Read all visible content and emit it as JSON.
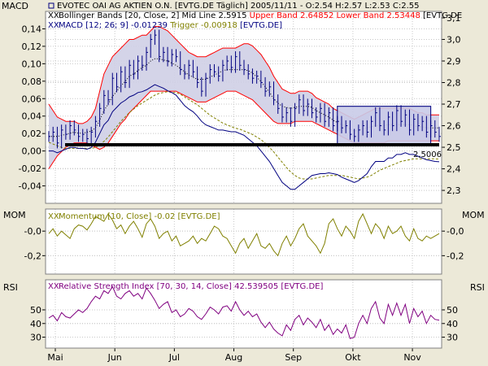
{
  "colors": {
    "background": "#ece9d8",
    "plot_bg": "#ffffff",
    "grid": "#c8c8c8",
    "price": "#000080",
    "band": "#ff0000",
    "band_fill": "#cfcfe6",
    "mid": "#000000",
    "macd": "#000080",
    "trigger": "#808000",
    "momentum": "#808000",
    "rsi": "#800080",
    "support": "#000000",
    "rect": "#000080",
    "rect_fill": "#c9cbe8"
  },
  "panels": {
    "macd_label_left": "MACD",
    "mom_label_left": "MOM",
    "mom_label_right": "MOM",
    "rsi_label_left": "RSI",
    "rsi_label_right": "RSI"
  },
  "legend": {
    "line1": "EVOTEC OAI AG AKTIEN O.N. [EVTG.DE  Täglich] 2005/11/11 - O:2.54 H:2.57 L:2.53 C:2.55",
    "line2_a": "Bollinger Bands [20, Close, 2] Mid Line 2.5915 ",
    "line2_b": "Upper Band 2.64852 Lower Band 2.53448",
    "line2_c": " [EVTG.DE",
    "line3_a": "MACD [12; 26; 9] -0.01239 ",
    "line3_b": "Trigger -0.00918",
    "line3_c": " [EVTG.DE]",
    "mom": "Momentum [10, Close] -0.02 [EVTG.DE]",
    "rsi": "Relative Strength Index [70, 30, 14, Close] 42.539505 [EVTG.DE]",
    "support_value": "2,5006"
  },
  "chart_data": {
    "type": "line",
    "x_months": [
      "Mai",
      "Jun",
      "Jul",
      "Aug",
      "Sep",
      "Okt",
      "Nov"
    ],
    "main": {
      "y_left_ticks": [
        "0,14",
        "0,12",
        "0,10",
        "0,08",
        "0,06",
        "0,04",
        "0,02",
        "0,00",
        "-0,02",
        "-0,04"
      ],
      "y_left_range": [
        -0.06,
        0.16
      ],
      "y_right_ticks": [
        "3,1",
        "3,0",
        "2,9",
        "2,8",
        "2,7",
        "2,6",
        "2,5",
        "2,4",
        "2,3"
      ],
      "y_right_range": [
        2.24,
        3.13
      ],
      "price": [
        2.55,
        2.57,
        2.52,
        2.58,
        2.56,
        2.6,
        2.58,
        2.55,
        2.56,
        2.54,
        2.57,
        2.62,
        2.68,
        2.74,
        2.72,
        2.82,
        2.78,
        2.85,
        2.8,
        2.88,
        2.84,
        2.9,
        2.88,
        2.94,
        3.0,
        3.02,
        2.92,
        2.94,
        2.9,
        2.93,
        2.92,
        2.86,
        2.84,
        2.88,
        2.85,
        2.8,
        2.76,
        2.82,
        2.86,
        2.85,
        2.83,
        2.88,
        2.9,
        2.87,
        2.92,
        2.88,
        2.86,
        2.84,
        2.82,
        2.83,
        2.8,
        2.76,
        2.78,
        2.72,
        2.68,
        2.64,
        2.66,
        2.62,
        2.68,
        2.72,
        2.67,
        2.7,
        2.66,
        2.64,
        2.68,
        2.62,
        2.66,
        2.6,
        2.62,
        2.59,
        2.6,
        2.56,
        2.55,
        2.58,
        2.6,
        2.57,
        2.62,
        2.66,
        2.6,
        2.58,
        2.64,
        2.6,
        2.67,
        2.62,
        2.65,
        2.58,
        2.63,
        2.6,
        2.62,
        2.57,
        2.6,
        2.57,
        2.55
      ],
      "upper_band": [
        2.7,
        2.67,
        2.64,
        2.63,
        2.62,
        2.62,
        2.62,
        2.61,
        2.61,
        2.62,
        2.64,
        2.68,
        2.76,
        2.84,
        2.88,
        2.92,
        2.94,
        2.96,
        2.98,
        3.0,
        3.0,
        3.01,
        3.02,
        3.02,
        3.04,
        3.06,
        3.06,
        3.05,
        3.04,
        3.02,
        3.0,
        2.98,
        2.96,
        2.94,
        2.93,
        2.92,
        2.92,
        2.92,
        2.93,
        2.94,
        2.95,
        2.96,
        2.96,
        2.96,
        2.96,
        2.97,
        2.98,
        2.98,
        2.97,
        2.95,
        2.93,
        2.9,
        2.87,
        2.83,
        2.8,
        2.77,
        2.76,
        2.75,
        2.75,
        2.76,
        2.76,
        2.76,
        2.75,
        2.73,
        2.72,
        2.71,
        2.7,
        2.68,
        2.67,
        2.66,
        2.65,
        2.64,
        2.63,
        2.64,
        2.65,
        2.66,
        2.67,
        2.68,
        2.68,
        2.68,
        2.68,
        2.68,
        2.68,
        2.68,
        2.68,
        2.68,
        2.67,
        2.66,
        2.66,
        2.65,
        2.65,
        2.65,
        2.65
      ],
      "lower_band": [
        2.4,
        2.43,
        2.46,
        2.48,
        2.5,
        2.51,
        2.52,
        2.52,
        2.52,
        2.52,
        2.51,
        2.5,
        2.49,
        2.5,
        2.52,
        2.55,
        2.58,
        2.61,
        2.63,
        2.66,
        2.68,
        2.7,
        2.72,
        2.74,
        2.76,
        2.76,
        2.76,
        2.76,
        2.76,
        2.76,
        2.76,
        2.75,
        2.74,
        2.73,
        2.72,
        2.71,
        2.71,
        2.71,
        2.72,
        2.73,
        2.74,
        2.75,
        2.76,
        2.76,
        2.76,
        2.75,
        2.74,
        2.73,
        2.72,
        2.7,
        2.68,
        2.66,
        2.64,
        2.62,
        2.61,
        2.61,
        2.61,
        2.61,
        2.62,
        2.62,
        2.62,
        2.62,
        2.62,
        2.61,
        2.6,
        2.59,
        2.58,
        2.57,
        2.56,
        2.55,
        2.54,
        2.53,
        2.52,
        2.52,
        2.52,
        2.52,
        2.52,
        2.52,
        2.52,
        2.52,
        2.53,
        2.53,
        2.53,
        2.53,
        2.53,
        2.53,
        2.53,
        2.53,
        2.53,
        2.53,
        2.53,
        2.53,
        2.53
      ],
      "macd": [
        0.0,
        0.0,
        -0.002,
        0.0,
        0.002,
        0.004,
        0.004,
        0.003,
        0.003,
        0.002,
        0.004,
        0.01,
        0.02,
        0.03,
        0.035,
        0.045,
        0.05,
        0.055,
        0.058,
        0.062,
        0.064,
        0.067,
        0.068,
        0.07,
        0.073,
        0.076,
        0.074,
        0.072,
        0.069,
        0.067,
        0.064,
        0.058,
        0.052,
        0.048,
        0.045,
        0.04,
        0.034,
        0.03,
        0.028,
        0.026,
        0.024,
        0.024,
        0.023,
        0.022,
        0.022,
        0.02,
        0.018,
        0.014,
        0.01,
        0.006,
        0.0,
        -0.006,
        -0.012,
        -0.02,
        -0.028,
        -0.036,
        -0.04,
        -0.044,
        -0.044,
        -0.04,
        -0.036,
        -0.032,
        -0.028,
        -0.027,
        -0.026,
        -0.026,
        -0.025,
        -0.026,
        -0.027,
        -0.03,
        -0.032,
        -0.034,
        -0.036,
        -0.034,
        -0.03,
        -0.026,
        -0.018,
        -0.012,
        -0.012,
        -0.012,
        -0.008,
        -0.008,
        -0.004,
        -0.004,
        -0.002,
        -0.004,
        -0.004,
        -0.006,
        -0.008,
        -0.01,
        -0.011,
        -0.012,
        -0.0124
      ],
      "trigger": [
        0.01,
        0.008,
        0.006,
        0.004,
        0.003,
        0.003,
        0.003,
        0.003,
        0.003,
        0.003,
        0.003,
        0.004,
        0.007,
        0.011,
        0.016,
        0.022,
        0.028,
        0.034,
        0.039,
        0.044,
        0.048,
        0.052,
        0.055,
        0.058,
        0.061,
        0.064,
        0.066,
        0.067,
        0.068,
        0.067,
        0.067,
        0.065,
        0.062,
        0.059,
        0.056,
        0.053,
        0.049,
        0.045,
        0.041,
        0.038,
        0.035,
        0.032,
        0.03,
        0.028,
        0.026,
        0.025,
        0.023,
        0.021,
        0.019,
        0.016,
        0.013,
        0.009,
        0.004,
        -0.001,
        -0.007,
        -0.013,
        -0.019,
        -0.024,
        -0.028,
        -0.031,
        -0.032,
        -0.032,
        -0.032,
        -0.031,
        -0.03,
        -0.029,
        -0.028,
        -0.028,
        -0.028,
        -0.028,
        -0.029,
        -0.03,
        -0.031,
        -0.032,
        -0.031,
        -0.03,
        -0.028,
        -0.025,
        -0.022,
        -0.02,
        -0.018,
        -0.016,
        -0.014,
        -0.012,
        -0.011,
        -0.01,
        -0.009,
        -0.009,
        -0.009,
        -0.009,
        -0.009,
        -0.009,
        -0.0092
      ],
      "support_level": 2.5,
      "consolidation_box": {
        "start_index": 68,
        "end_index": 90,
        "low": 2.51,
        "high": 2.69
      }
    },
    "momentum": {
      "y_left_ticks": [
        "-0,0",
        "-0,2"
      ],
      "y_right_ticks": [
        "-0,0",
        "-0,2"
      ],
      "y_range": [
        -0.35,
        0.18
      ],
      "values": [
        -0.02,
        0.02,
        -0.04,
        0.0,
        -0.03,
        -0.06,
        0.02,
        0.05,
        0.04,
        0.01,
        0.06,
        0.12,
        0.1,
        0.08,
        0.14,
        0.09,
        0.02,
        0.05,
        -0.02,
        0.04,
        0.08,
        0.02,
        -0.05,
        0.06,
        0.1,
        0.04,
        -0.06,
        -0.02,
        0.0,
        -0.08,
        -0.04,
        -0.12,
        -0.1,
        -0.08,
        -0.04,
        -0.1,
        -0.06,
        -0.08,
        -0.02,
        0.04,
        0.02,
        -0.04,
        -0.06,
        -0.12,
        -0.18,
        -0.1,
        -0.06,
        -0.14,
        -0.08,
        -0.02,
        -0.12,
        -0.14,
        -0.1,
        -0.16,
        -0.2,
        -0.1,
        -0.04,
        -0.12,
        -0.06,
        0.02,
        0.06,
        -0.04,
        -0.08,
        -0.12,
        -0.18,
        -0.1,
        0.06,
        0.1,
        0.02,
        -0.04,
        0.04,
        0.0,
        -0.06,
        0.08,
        0.14,
        0.06,
        -0.02,
        0.06,
        0.02,
        -0.06,
        0.04,
        -0.02,
        0.0,
        0.04,
        -0.04,
        -0.08,
        0.02,
        -0.06,
        -0.08,
        -0.04,
        -0.06,
        -0.04,
        -0.02
      ]
    },
    "rsi": {
      "y_left_ticks": [
        "50",
        "40",
        "30"
      ],
      "y_right_ticks": [
        "50",
        "40",
        "30"
      ],
      "y_range": [
        22,
        72
      ],
      "values": [
        44,
        46,
        42,
        48,
        45,
        44,
        47,
        50,
        48,
        51,
        56,
        60,
        58,
        64,
        62,
        67,
        60,
        58,
        62,
        64,
        60,
        62,
        58,
        66,
        62,
        57,
        51,
        54,
        56,
        48,
        50,
        45,
        47,
        51,
        49,
        45,
        43,
        47,
        52,
        50,
        47,
        52,
        53,
        49,
        56,
        50,
        46,
        49,
        45,
        47,
        41,
        37,
        41,
        36,
        33,
        31,
        39,
        35,
        43,
        46,
        39,
        44,
        41,
        37,
        43,
        35,
        39,
        32,
        36,
        33,
        39,
        29,
        30,
        40,
        46,
        40,
        51,
        56,
        44,
        40,
        54,
        46,
        55,
        46,
        54,
        40,
        51,
        45,
        49,
        40,
        46,
        43,
        42.5
      ]
    }
  }
}
